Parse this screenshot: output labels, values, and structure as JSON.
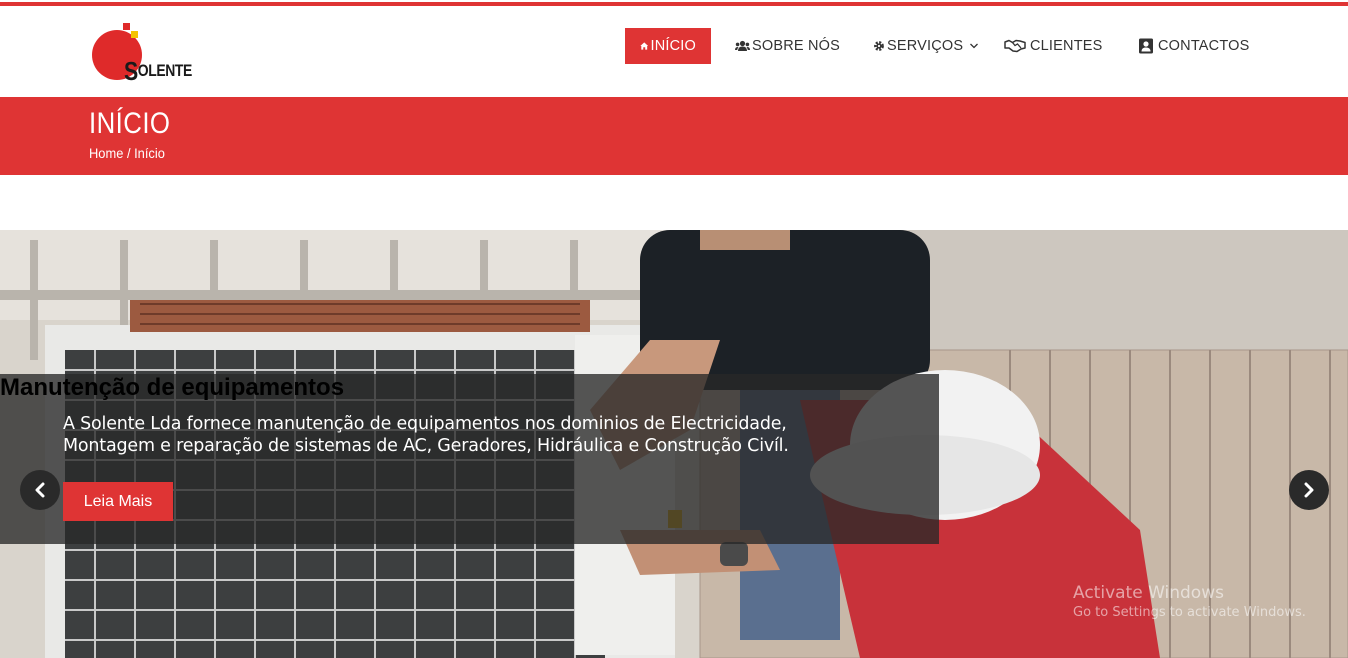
{
  "logo": {
    "text": "SOLENTE"
  },
  "nav": {
    "items": [
      {
        "label": "INÍCIO",
        "icon": "home-icon",
        "active": true
      },
      {
        "label": "SOBRE NÓS",
        "icon": "users-icon",
        "active": false
      },
      {
        "label": "SERVIÇOS",
        "icon": "gear-icon",
        "active": false,
        "has_dropdown": true
      },
      {
        "label": "CLIENTES",
        "icon": "handshake-icon",
        "active": false
      },
      {
        "label": "CONTACTOS",
        "icon": "contact-card-icon",
        "active": false
      }
    ]
  },
  "banner": {
    "title": "INÍCIO",
    "breadcrumb": {
      "home": "Home",
      "separator": " / ",
      "current": "Início"
    }
  },
  "slide": {
    "title": "Manutenção de equipamentos",
    "text": "A Solente Lda fornece manutenção de equipamentos nos dominios de Electricidade, Montagem e reparação de sistemas de AC, Geradores, Hidráulica e Construção Civíl.",
    "button": "Leia Mais"
  },
  "watermark": {
    "line1": "Activate Windows",
    "line2": "Go to Settings to activate Windows."
  },
  "colors": {
    "accent": "#df3434",
    "text": "#333333"
  }
}
